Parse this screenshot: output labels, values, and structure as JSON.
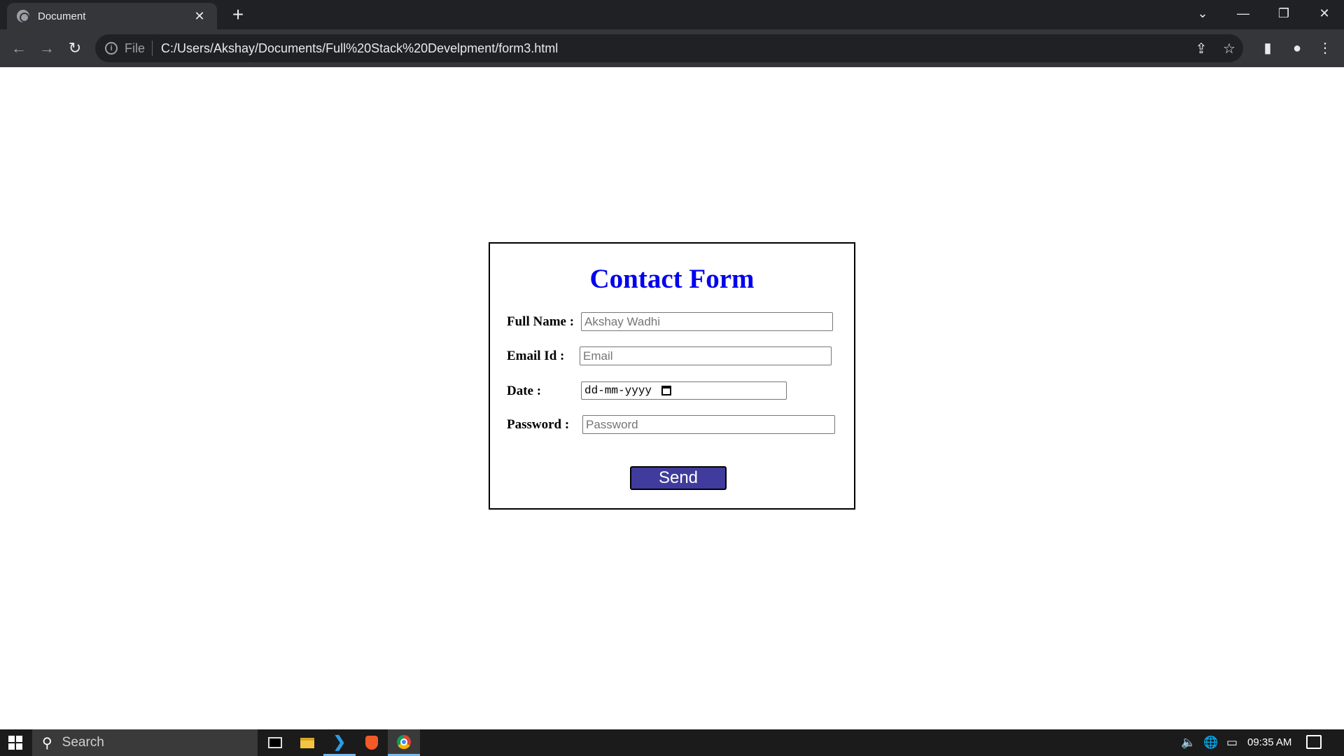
{
  "browser": {
    "tab_title": "Document",
    "tab_close": "✕",
    "new_tab": "+",
    "window_controls": {
      "tab_search": "⌄",
      "minimize": "—",
      "restore": "❐",
      "close": "✕"
    },
    "nav": {
      "back": "←",
      "forward": "→",
      "reload": "↻"
    },
    "omnibox": {
      "info_glyph": "i",
      "scheme_label": "File",
      "url": "C:/Users/Akshay/Documents/Full%20Stack%20Develpment/form3.html",
      "share_glyph": "⇪",
      "star_glyph": "☆"
    },
    "toolbar_icons": {
      "side_panel": "▮",
      "profile": "●",
      "menu": "⋮"
    }
  },
  "form": {
    "title": "Contact Form",
    "full_name": {
      "label": "Full Name :",
      "placeholder": "Akshay Wadhi"
    },
    "email": {
      "label": "Email Id :",
      "placeholder": "Email"
    },
    "date": {
      "label": "Date :",
      "placeholder": "dd-mm-yyyy"
    },
    "password": {
      "label": "Password :",
      "placeholder": "Password"
    },
    "send_label": "Send"
  },
  "taskbar": {
    "search_glyph": "⚲",
    "search_label": "Search",
    "vscode_glyph": "❯",
    "tray": {
      "volume": "🔈",
      "network": "🌐",
      "battery": "▭"
    },
    "clock": "09:35 AM"
  }
}
